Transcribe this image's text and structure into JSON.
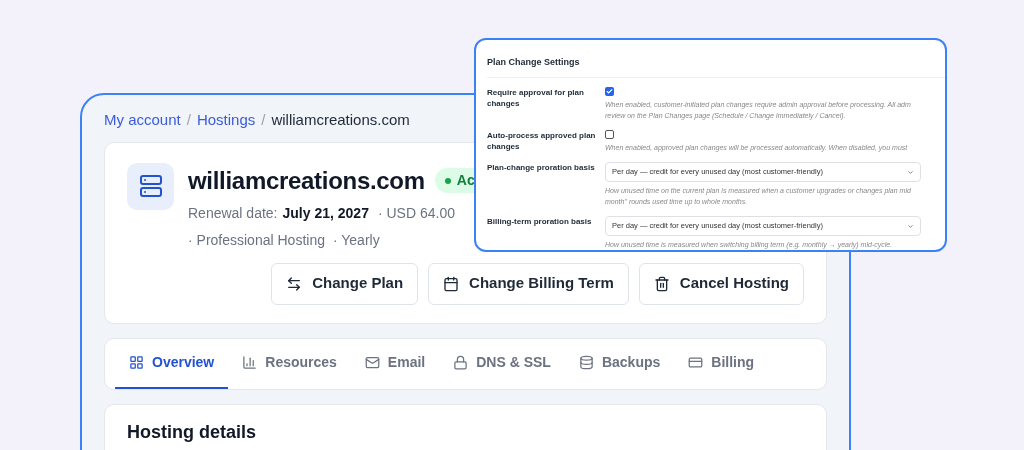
{
  "breadcrumb": [
    {
      "label": "My account",
      "kind": "link"
    },
    {
      "separator": "/",
      "label": "Hostings",
      "kind": "link"
    },
    {
      "separator": "/",
      "label": "williamcreations.com",
      "kind": "current"
    }
  ],
  "hosting": {
    "domain": "williamcreations.com",
    "status": "Ac",
    "renewal_label": "Renewal date:",
    "renewal_date": "July 21, 2027",
    "price": "· USD 64.00",
    "plan": "· Professional Hosting",
    "term": "· Yearly"
  },
  "actions": [
    {
      "label": "Change Plan"
    },
    {
      "label": "Change Billing Term"
    },
    {
      "label": "Cancel Hosting"
    }
  ],
  "tabs": [
    {
      "label": "Overview",
      "selected": true
    },
    {
      "label": "Resources",
      "selected": false
    },
    {
      "label": "Email",
      "selected": false
    },
    {
      "label": "DNS & SSL",
      "selected": false
    },
    {
      "label": "Backups",
      "selected": false
    },
    {
      "label": "Billing",
      "selected": false
    }
  ],
  "details_title": "Hosting details",
  "settings": {
    "title": "Plan Change Settings",
    "rows": [
      {
        "kind": "checkbox",
        "label": "Require approval for plan changes",
        "checked": true,
        "help": [
          "When enabled, customer-initiated plan changes require admin approval before processing. All adm",
          "review on the Plan Changes page (Schedule / Change Immediately / Cancel)."
        ]
      },
      {
        "kind": "checkbox",
        "label": "Auto-process approved plan changes",
        "checked": false,
        "help": [
          "When enabled, approved plan changes will be processed automatically. When disabled, you must"
        ]
      },
      {
        "kind": "select",
        "label": "Plan-change proration basis",
        "value": "Per day — credit for every unused day (most customer-friendly)",
        "help": [
          "How unused time on the current plan is measured when a customer upgrades or changes plan mid",
          "month\" rounds used time up to whole months."
        ]
      },
      {
        "kind": "select",
        "label": "Billing-term proration basis",
        "value": "Per day — credit for every unused day (most customer-friendly)",
        "help": [
          "How unused time is measured when switching billing term (e.g. monthly → yearly) mid-cycle."
        ]
      }
    ]
  }
}
